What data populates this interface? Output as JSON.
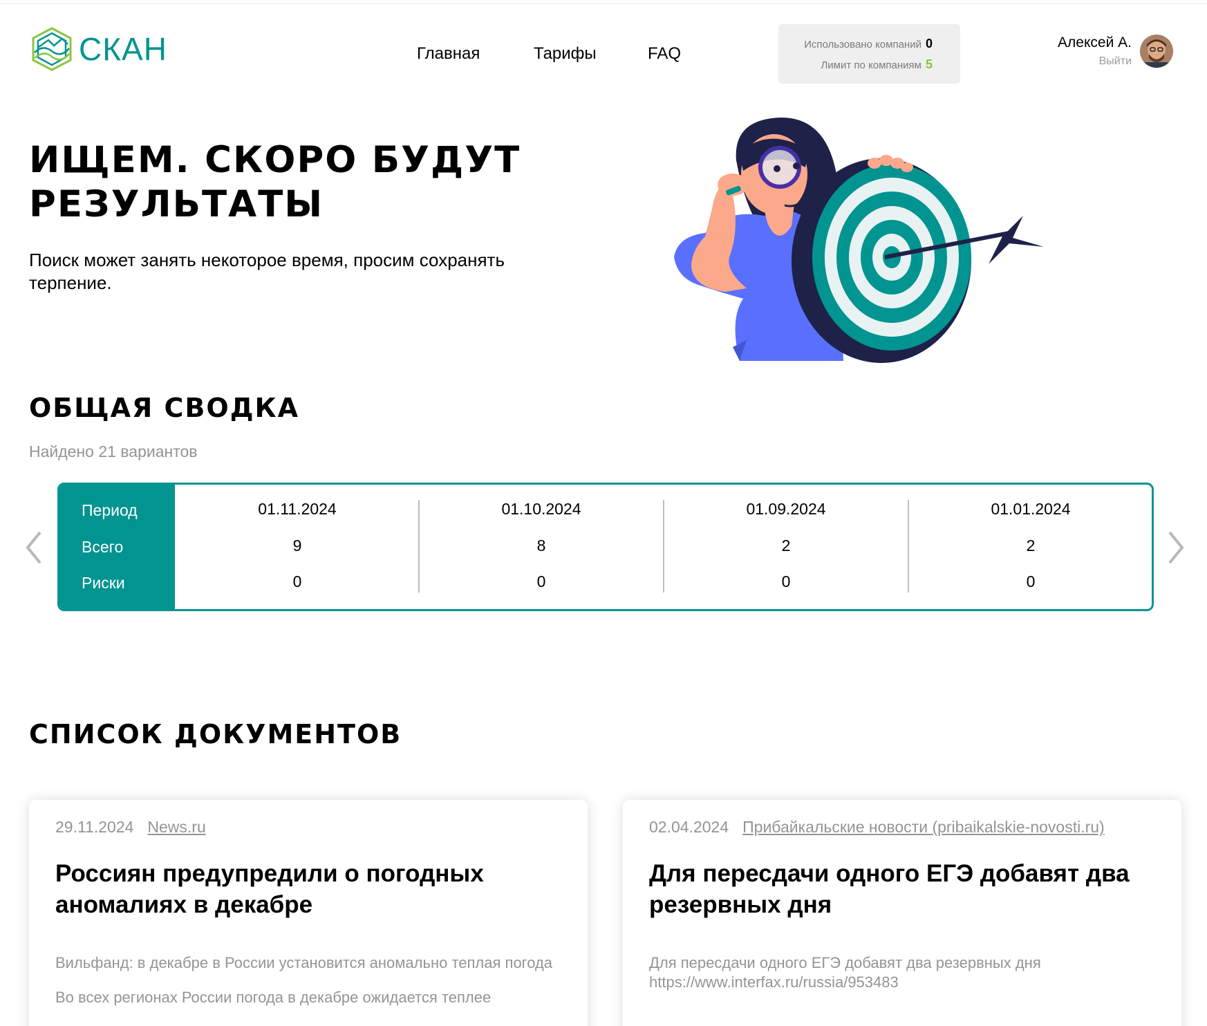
{
  "header": {
    "logo_text": "СКАН",
    "nav": [
      "Главная",
      "Тарифы",
      "FAQ"
    ],
    "limits": {
      "used_label": "Использовано компаний",
      "used_value": "0",
      "limit_label": "Лимит по компаниям",
      "limit_value": "5"
    },
    "user": {
      "name": "Алексей А.",
      "logout": "Выйти"
    }
  },
  "hero": {
    "title": "ИЩЕМ. СКОРО БУДУТ РЕЗУЛЬТАТЫ",
    "subtitle": "Поиск может занять некоторое время, просим сохранять терпение."
  },
  "summary": {
    "title": "ОБЩАЯ СВОДКА",
    "found": "Найдено 21 вариантов",
    "row_labels": [
      "Период",
      "Всего",
      "Риски"
    ],
    "columns": [
      {
        "period": "01.11.2024",
        "total": "9",
        "risks": "0"
      },
      {
        "period": "01.10.2024",
        "total": "8",
        "risks": "0"
      },
      {
        "period": "01.09.2024",
        "total": "2",
        "risks": "0"
      },
      {
        "period": "01.01.2024",
        "total": "2",
        "risks": "0"
      }
    ]
  },
  "documents": {
    "title": "СПИСОК ДОКУМЕНТОВ",
    "cards": [
      {
        "date": "29.11.2024",
        "source": "News.ru",
        "title": "Россиян предупредили о погодных аномалиях в декабре",
        "text1": "Вильфанд: в декабре в России установится аномально теплая погода",
        "text2": "Во всех регионах России погода в декабре ожидается теплее"
      },
      {
        "date": "02.04.2024",
        "source": "Прибайкальские новости (pribaikalskie-novosti.ru)",
        "title": "Для пересдачи одного ЕГЭ добавят два резервных дня",
        "text1": "Для пересдачи одного ЕГЭ добавят два резервных дня https://www.interfax.ru/russia/953483",
        "text2": ""
      }
    ]
  },
  "colors": {
    "brand": "#029491",
    "accent_green": "#8ac540",
    "muted": "#949494"
  }
}
